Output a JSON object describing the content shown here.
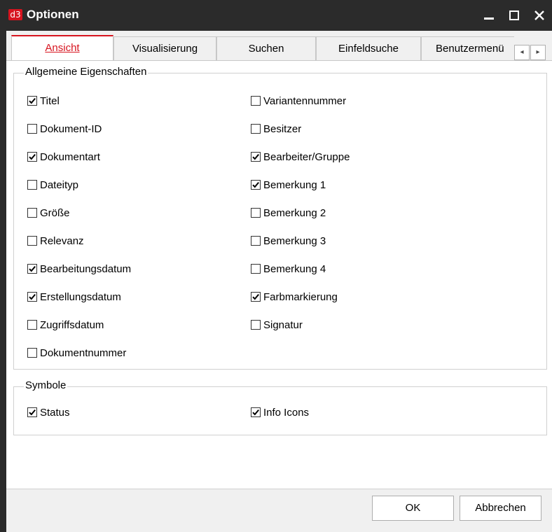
{
  "window": {
    "logo_text": "d3",
    "title": "Optionen",
    "minimize_glyph": "—",
    "maximize_glyph": "☐",
    "close_glyph": "✕"
  },
  "tabs": [
    {
      "label": "Ansicht",
      "active": true
    },
    {
      "label": "Visualisierung",
      "active": false
    },
    {
      "label": "Suchen",
      "active": false
    },
    {
      "label": "Einfeldsuche",
      "active": false
    },
    {
      "label": "Benutzermenü",
      "active": false
    }
  ],
  "tab_scroll": {
    "left_glyph": "◂",
    "right_glyph": "▸"
  },
  "general": {
    "title": "Allgemeine Eigenschaften",
    "left_items": [
      {
        "label": "Titel",
        "checked": true
      },
      {
        "label": "Dokument-ID",
        "checked": false
      },
      {
        "label": "Dokumentart",
        "checked": true
      },
      {
        "label": "Dateityp",
        "checked": false
      },
      {
        "label": "Größe",
        "checked": false
      },
      {
        "label": "Relevanz",
        "checked": false
      },
      {
        "label": "Bearbeitungsdatum",
        "checked": true
      },
      {
        "label": "Erstellungsdatum",
        "checked": true
      },
      {
        "label": "Zugriffsdatum",
        "checked": false
      },
      {
        "label": "Dokumentnummer",
        "checked": false
      }
    ],
    "right_items": [
      {
        "label": "Variantennummer",
        "checked": false
      },
      {
        "label": "Besitzer",
        "checked": false
      },
      {
        "label": "Bearbeiter/Gruppe",
        "checked": true
      },
      {
        "label": "Bemerkung 1",
        "checked": true
      },
      {
        "label": "Bemerkung 2",
        "checked": false
      },
      {
        "label": "Bemerkung 3",
        "checked": false
      },
      {
        "label": "Bemerkung 4",
        "checked": false
      },
      {
        "label": "Farbmarkierung",
        "checked": true
      },
      {
        "label": "Signatur",
        "checked": false
      }
    ]
  },
  "symbols": {
    "title": "Symbole",
    "items": [
      {
        "label": "Status",
        "checked": true
      },
      {
        "label": "Info Icons",
        "checked": true
      }
    ]
  },
  "buttons": {
    "ok": "OK",
    "cancel": "Abbrechen"
  },
  "colors": {
    "accent": "#d7141f",
    "titlebar": "#2b2b2b"
  }
}
